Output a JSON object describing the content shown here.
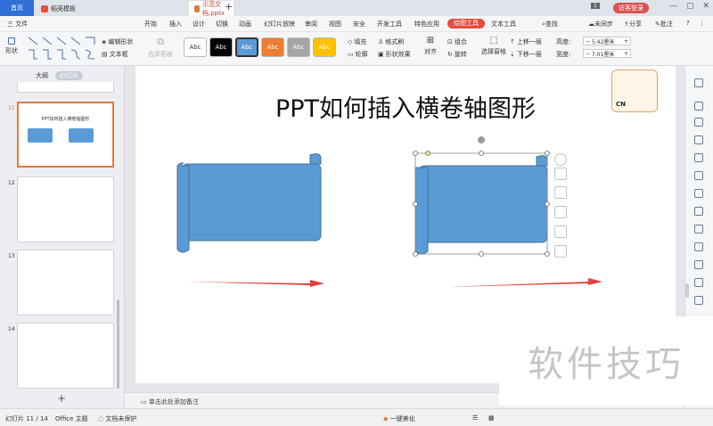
{
  "tabs": {
    "home": "首页",
    "template": "稻壳模板",
    "document": "示范文档.pptx"
  },
  "titlebar": {
    "page_badge": "1",
    "login": "访客登录"
  },
  "menu": {
    "file": "三 文件",
    "items": [
      "开始",
      "插入",
      "设计",
      "切换",
      "动画",
      "幻灯片放映",
      "审阅",
      "视图",
      "安全",
      "开发工具",
      "特色应用",
      "绘图工具",
      "文本工具"
    ],
    "active": "绘图工具",
    "search": "查找",
    "sync": "未同步",
    "share": "分享",
    "comment": "批注"
  },
  "ribbon": {
    "shape": "形状",
    "edit_shape": "编辑形状",
    "textbox": "文本框",
    "merge_shape": "合并形状",
    "style_labels": [
      "Abc",
      "Abc",
      "Abc",
      "Abc",
      "Abc",
      "Abc"
    ],
    "style_colors": [
      "#ffffff",
      "#000000",
      "#5b9bd5",
      "#ed7d31",
      "#a5a5a5",
      "#ffc000"
    ],
    "fill": "填充",
    "format_painter": "格式刷",
    "outline": "轮廓",
    "shape_effect": "形状效果",
    "align": "对齐",
    "group": "组合",
    "rotate": "旋转",
    "select_pane": "选择窗格",
    "bring_forward": "上移一层",
    "send_backward": "下移一层",
    "height_label": "高度:",
    "height_value": "5.42厘米",
    "width_label": "宽度:",
    "width_value": "7.01厘米"
  },
  "left_panel": {
    "outline_tab": "大纲",
    "slides_tab": "幻灯片",
    "slides": [
      {
        "num": "11",
        "title": "PPT如何插入横卷轴图形",
        "selected": true
      },
      {
        "num": "12",
        "title": "",
        "selected": false
      },
      {
        "num": "13",
        "title": "",
        "selected": false
      },
      {
        "num": "14",
        "title": "",
        "selected": false
      }
    ]
  },
  "slide": {
    "title": "PPT如何插入横卷轴图形",
    "scroll_color": "#5b9bd5",
    "arrow_color": "#e0413d"
  },
  "mascot": {
    "text": "CN"
  },
  "notes": {
    "placeholder": "单击此处添加备注"
  },
  "status": {
    "slide_info": "幻灯片 11 / 14",
    "theme": "Office 主题",
    "protect": "文档未保护",
    "beautify": "一键美化",
    "zoom": ""
  },
  "watermark": "软件技巧"
}
